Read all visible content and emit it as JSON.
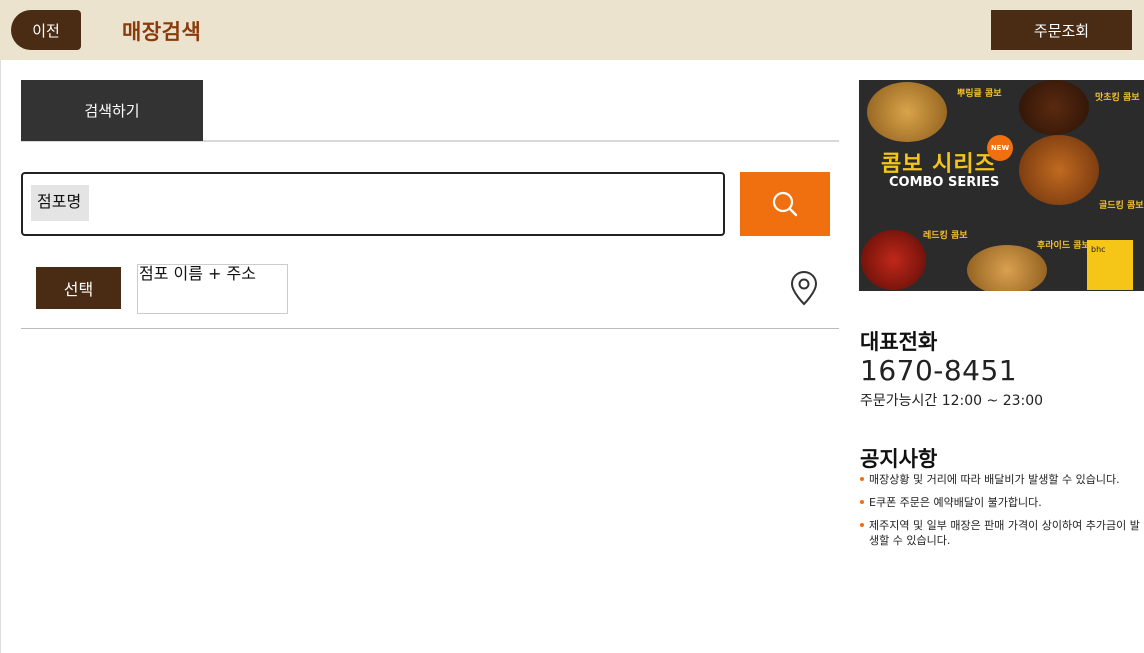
{
  "header": {
    "back_label": "이전",
    "title": "매장검색",
    "order_lookup_label": "주문조회"
  },
  "tabs": [
    {
      "label": "검색하기"
    }
  ],
  "search": {
    "field_label": "점포명",
    "value": "",
    "placeholder": "",
    "button_icon": "search-icon"
  },
  "result_row": {
    "select_label": "선택",
    "store_text": "점포 이름 + 주소",
    "map_icon": "map-pin-icon"
  },
  "banner": {
    "title_kr": "콤보 시리즈",
    "title_en": "COMBO SERIES",
    "badge": "NEW",
    "items": [
      "뿌링클 콤보",
      "맛초킹 콤보",
      "골드킹 콤보",
      "레드킹 콤보",
      "후라이드 콤보"
    ],
    "brand_tag": "bhc"
  },
  "contact": {
    "title": "대표전화",
    "number": "1670-8451",
    "hours": "주문가능시간 12:00 ~ 23:00"
  },
  "notice": {
    "title": "공지사항",
    "items": [
      "매장상황 및 거리에 따라 배달비가 발생할 수 있습니다.",
      "E쿠폰 주문은 예약배달이 불가합니다.",
      "제주지역 및 일부 매장은 판매 가격이 상이하여 추가금이 발생할 수 있습니다."
    ]
  },
  "colors": {
    "header_bg": "#ece3cf",
    "brown": "#4a2c14",
    "title_brown": "#8b3a0a",
    "accent_orange": "#f07010"
  }
}
